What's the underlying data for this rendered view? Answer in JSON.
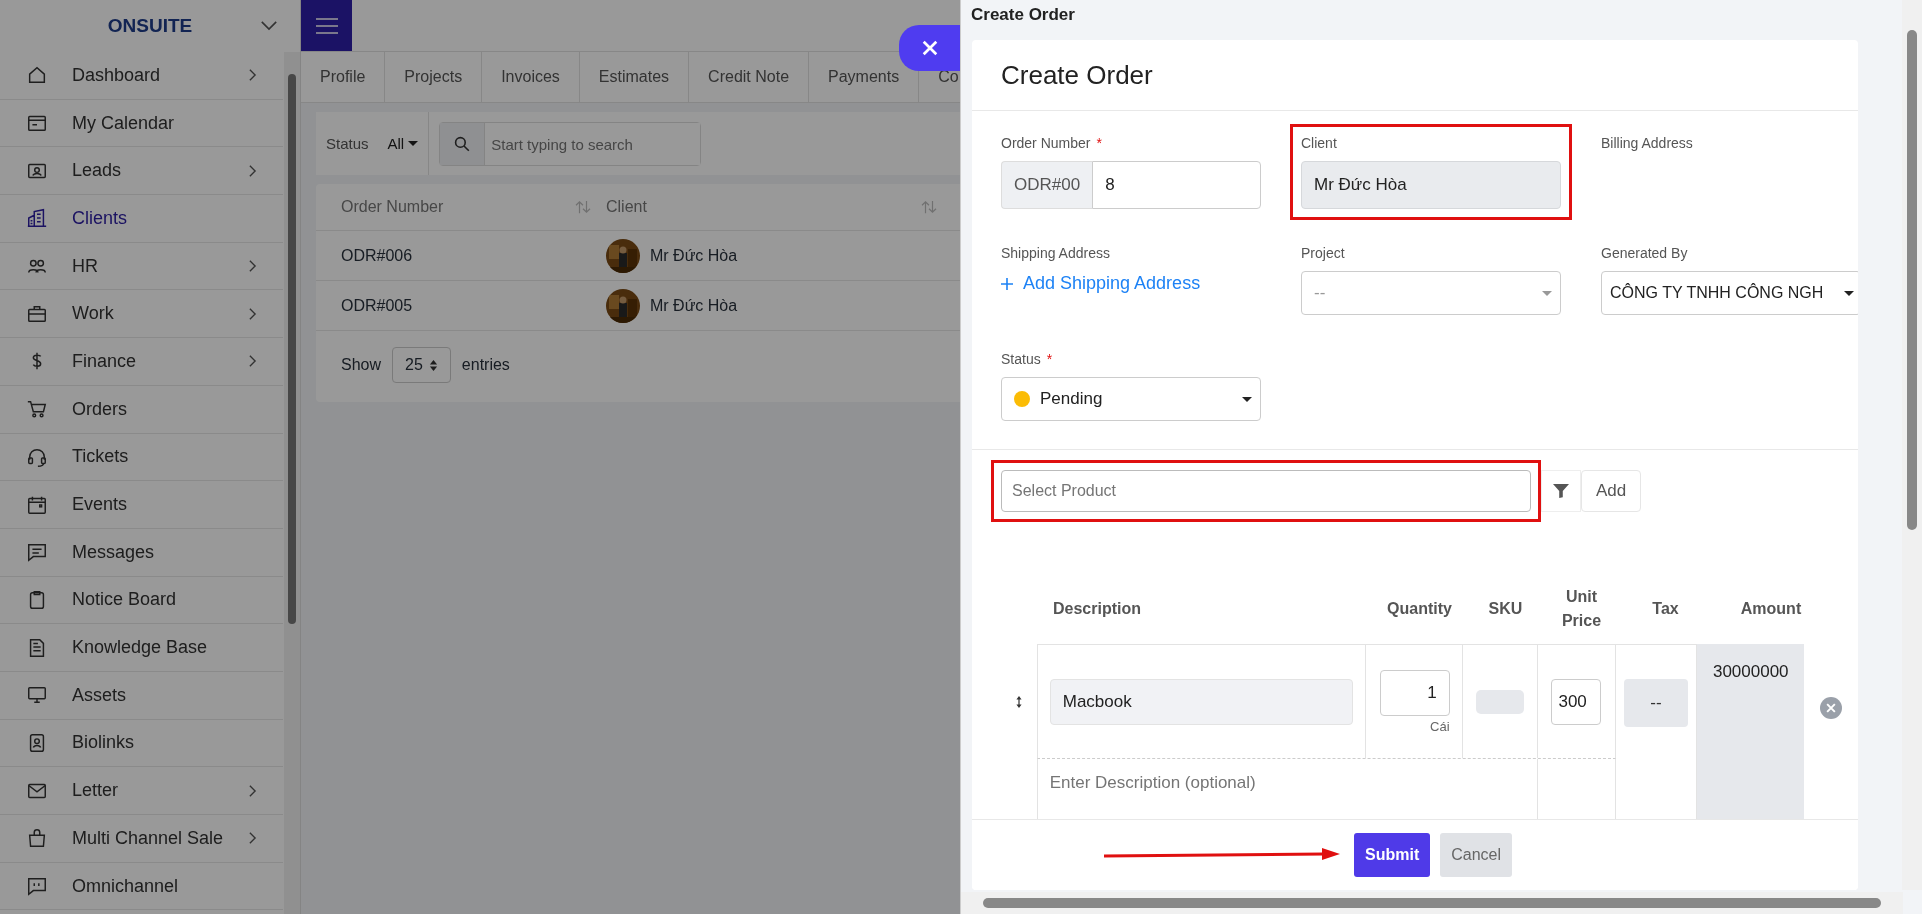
{
  "sidebar": {
    "brand": "ONSUITE",
    "items": [
      {
        "label": "Dashboard",
        "submenu": true,
        "selected": false
      },
      {
        "label": "My Calendar",
        "submenu": false,
        "selected": false
      },
      {
        "label": "Leads",
        "submenu": true,
        "selected": false
      },
      {
        "label": "Clients",
        "submenu": false,
        "selected": true
      },
      {
        "label": "HR",
        "submenu": true,
        "selected": false
      },
      {
        "label": "Work",
        "submenu": true,
        "selected": false
      },
      {
        "label": "Finance",
        "submenu": true,
        "selected": false
      },
      {
        "label": "Orders",
        "submenu": false,
        "selected": false
      },
      {
        "label": "Tickets",
        "submenu": false,
        "selected": false
      },
      {
        "label": "Events",
        "submenu": false,
        "selected": false
      },
      {
        "label": "Messages",
        "submenu": false,
        "selected": false
      },
      {
        "label": "Notice Board",
        "submenu": false,
        "selected": false
      },
      {
        "label": "Knowledge Base",
        "submenu": false,
        "selected": false
      },
      {
        "label": "Assets",
        "submenu": false,
        "selected": false
      },
      {
        "label": "Biolinks",
        "submenu": false,
        "selected": false
      },
      {
        "label": "Letter",
        "submenu": true,
        "selected": false
      },
      {
        "label": "Multi Channel Sale",
        "submenu": true,
        "selected": false
      },
      {
        "label": "Omnichannel",
        "submenu": false,
        "selected": false
      }
    ]
  },
  "tabs": [
    {
      "label": "Profile"
    },
    {
      "label": "Projects"
    },
    {
      "label": "Invoices"
    },
    {
      "label": "Estimates"
    },
    {
      "label": "Credit Note"
    },
    {
      "label": "Payments"
    },
    {
      "label": "Co"
    }
  ],
  "filters": {
    "status_label": "Status",
    "status_value": "All",
    "search_placeholder": "Start typing to search"
  },
  "orders_table": {
    "columns": [
      "Order Number",
      "Client"
    ],
    "rows": [
      {
        "order_number": "ODR#006",
        "client": "Mr Đức Hòa"
      },
      {
        "order_number": "ODR#005",
        "client": "Mr Đức Hòa"
      }
    ]
  },
  "pagination": {
    "show": "Show",
    "page_size": "25",
    "entries": "entries"
  },
  "modal": {
    "window_title": "Create Order",
    "title": "Create Order",
    "order_number": {
      "label": "Order Number",
      "required_mark": "*",
      "prefix": "ODR#00",
      "value": "8"
    },
    "client": {
      "label": "Client",
      "value": "Mr Đức Hòa",
      "highlighted": true
    },
    "billing_address": {
      "label": "Billing Address"
    },
    "shipping_address": {
      "label": "Shipping Address",
      "link": "Add Shipping Address"
    },
    "project": {
      "label": "Project",
      "placeholder": "--"
    },
    "generated_by": {
      "label": "Generated By",
      "value": "CÔNG TY TNHH CÔNG NGH"
    },
    "status": {
      "label": "Status",
      "required_mark": "*",
      "value": "Pending",
      "color": "#fbbc05"
    },
    "product_search": {
      "placeholder": "Select Product",
      "highlighted": true,
      "add": "Add"
    },
    "items_table": {
      "columns": [
        "Description",
        "Quantity",
        "SKU",
        "Unit Price",
        "Tax",
        "Amount"
      ],
      "rows": [
        {
          "description": "Macbook",
          "quantity": "1",
          "unit": "Cái",
          "unit_price": "300",
          "tax": "--",
          "amount": "30000000",
          "description_placeholder": "Enter Description (optional)"
        }
      ]
    },
    "submit": "Submit",
    "cancel": "Cancel",
    "submit_pointed": true
  }
}
